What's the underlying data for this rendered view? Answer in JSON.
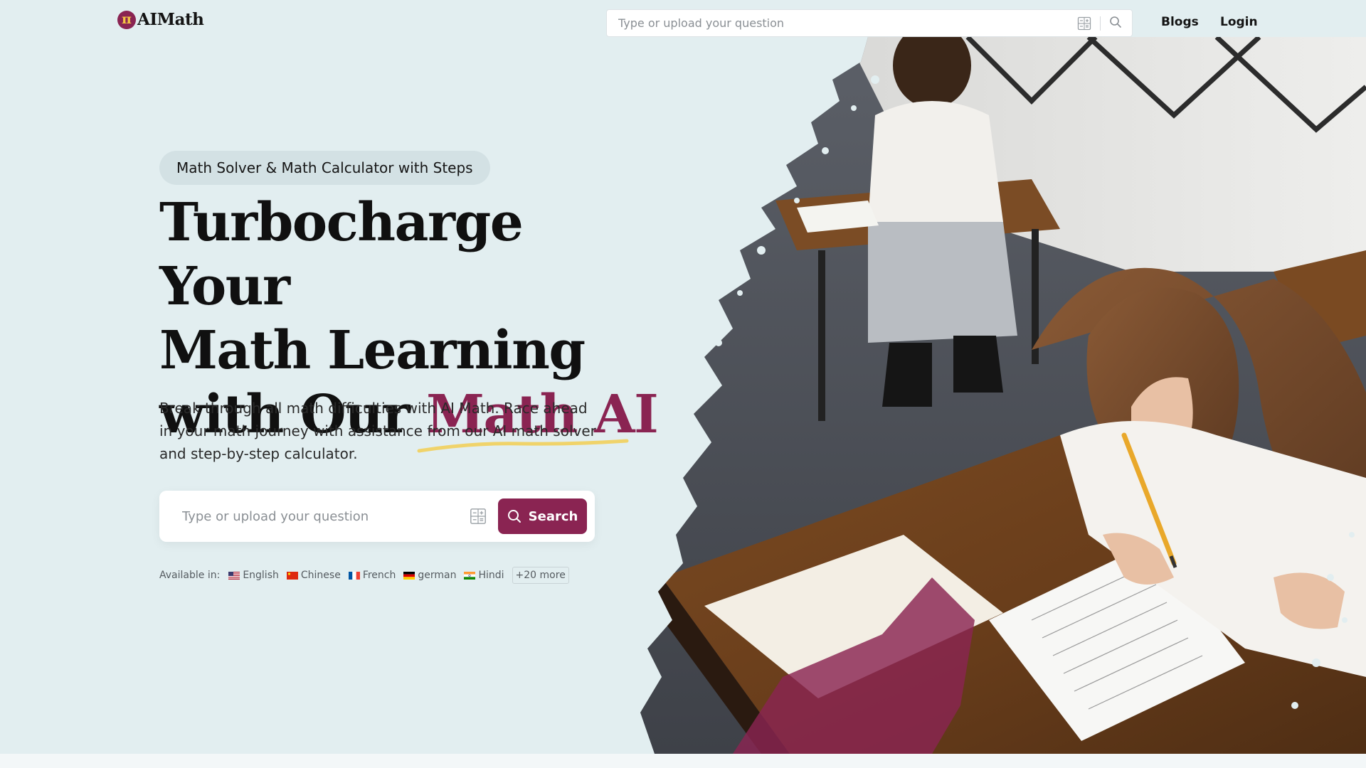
{
  "header": {
    "logo_text": "AIMath",
    "logo_mark": "π",
    "search_placeholder": "Type or upload your question",
    "nav": {
      "blogs": "Blogs",
      "login": "Login"
    }
  },
  "hero": {
    "tagline": "Math Solver & Math Calculator with Steps",
    "headline_line1": "Turbocharge Your",
    "headline_line2": "Math Learning",
    "headline_line3_prefix": "with Our ",
    "headline_accent": "Math AI",
    "subtext": "Break through all math difficulties with AI Math. Race ahead in your math journey with assistance from our AI math solver and step-by-step calculator.",
    "search_placeholder": "Type or upload your question",
    "search_button": "Search",
    "available_label": "Available in:",
    "languages": [
      {
        "name": "English",
        "flag": "us-flag-icon"
      },
      {
        "name": "Chinese",
        "flag": "cn-flag-icon"
      },
      {
        "name": "French",
        "flag": "fr-flag-icon"
      },
      {
        "name": "german",
        "flag": "de-flag-icon"
      },
      {
        "name": "Hindi",
        "flag": "in-flag-icon"
      }
    ],
    "more_languages": "+20 more"
  },
  "colors": {
    "brand": "#8a2452",
    "accent_underline": "#f0d36a",
    "background": "#e2eef0"
  }
}
